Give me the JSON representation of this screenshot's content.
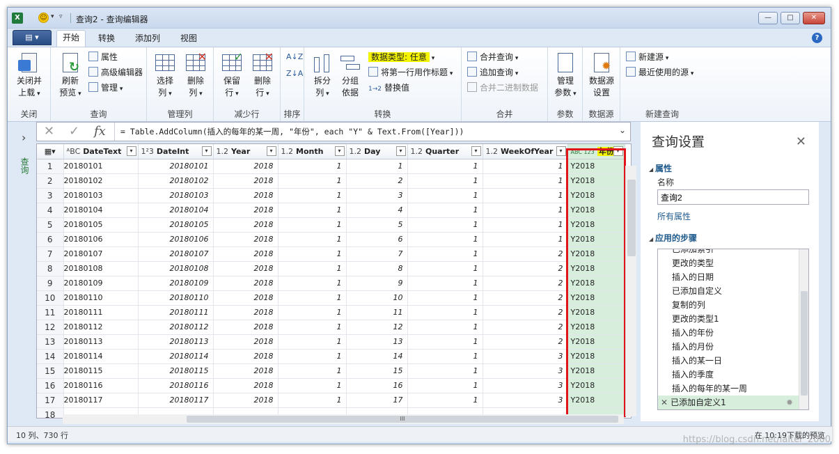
{
  "window": {
    "app_icon": "X",
    "title": "查询2 - 查询编辑器",
    "buttons": {
      "minimize": "—",
      "maximize": "□",
      "close": "✕"
    }
  },
  "ribbon_tabs": {
    "file": "▤ ▾",
    "tabs": [
      "开始",
      "转换",
      "添加列",
      "视图"
    ]
  },
  "ribbon": {
    "close": {
      "btn": "关闭并\n上载",
      "label1": "关闭并",
      "label2": "上载",
      "group": "关闭"
    },
    "query": {
      "refresh1": "刷新",
      "refresh2": "预览",
      "properties": "属性",
      "advanced_editor": "高级编辑器",
      "manage": "管理",
      "group": "查询"
    },
    "manage_cols": {
      "choose1": "选择",
      "choose2": "列",
      "remove1": "删除",
      "remove2": "列",
      "group": "管理列"
    },
    "reduce_rows": {
      "keep1": "保留",
      "keep2": "行",
      "remove1": "删除",
      "remove2": "行",
      "group": "减少行"
    },
    "sort": {
      "group": "排序"
    },
    "transform": {
      "split1": "拆分",
      "split2": "列",
      "group_by1": "分组",
      "group_by2": "依据",
      "data_type": "数据类型: 任意",
      "first_row_header": "将第一行用作标题",
      "replace_values": "替换值",
      "group": "转换"
    },
    "combine": {
      "merge": "合并查询",
      "append": "追加查询",
      "combine_binaries": "合并二进制数据",
      "group": "合并"
    },
    "params": {
      "manage1": "管理",
      "manage2": "参数",
      "group": "参数"
    },
    "datasource": {
      "settings1": "数据源",
      "settings2": "设置",
      "group": "数据源"
    },
    "new_query": {
      "new_source": "新建源",
      "recent_sources": "最近使用的源",
      "group": "新建查询"
    }
  },
  "left_nav": {
    "label": "查询",
    "arrow": "›"
  },
  "formula_bar": {
    "cancel": "✕",
    "accept": "✓",
    "fx": "fx",
    "formula": "= Table.AddColumn(插入的每年的某一周, \"年份\", each \"Y\" & Text.From([Year]))"
  },
  "grid": {
    "columns": [
      {
        "type": "ᴬBC",
        "name": "DateText"
      },
      {
        "type": "1²3",
        "name": "DateInt"
      },
      {
        "type": "1.2",
        "name": "Year"
      },
      {
        "type": "1.2",
        "name": "Month"
      },
      {
        "type": "1.2",
        "name": "Day"
      },
      {
        "type": "1.2",
        "name": "Quarter"
      },
      {
        "type": "1.2",
        "name": "WeekOfYear"
      },
      {
        "type": "ABC 123",
        "name": "年份"
      }
    ],
    "rows": [
      {
        "n": "1",
        "dt": "20180101",
        "di": "20180101",
        "y": "2018",
        "m": "1",
        "d": "1",
        "q": "1",
        "w": "1",
        "nf": "Y2018"
      },
      {
        "n": "2",
        "dt": "20180102",
        "di": "20180102",
        "y": "2018",
        "m": "1",
        "d": "2",
        "q": "1",
        "w": "1",
        "nf": "Y2018"
      },
      {
        "n": "3",
        "dt": "20180103",
        "di": "20180103",
        "y": "2018",
        "m": "1",
        "d": "3",
        "q": "1",
        "w": "1",
        "nf": "Y2018"
      },
      {
        "n": "4",
        "dt": "20180104",
        "di": "20180104",
        "y": "2018",
        "m": "1",
        "d": "4",
        "q": "1",
        "w": "1",
        "nf": "Y2018"
      },
      {
        "n": "5",
        "dt": "20180105",
        "di": "20180105",
        "y": "2018",
        "m": "1",
        "d": "5",
        "q": "1",
        "w": "1",
        "nf": "Y2018"
      },
      {
        "n": "6",
        "dt": "20180106",
        "di": "20180106",
        "y": "2018",
        "m": "1",
        "d": "6",
        "q": "1",
        "w": "1",
        "nf": "Y2018"
      },
      {
        "n": "7",
        "dt": "20180107",
        "di": "20180107",
        "y": "2018",
        "m": "1",
        "d": "7",
        "q": "1",
        "w": "2",
        "nf": "Y2018"
      },
      {
        "n": "8",
        "dt": "20180108",
        "di": "20180108",
        "y": "2018",
        "m": "1",
        "d": "8",
        "q": "1",
        "w": "2",
        "nf": "Y2018"
      },
      {
        "n": "9",
        "dt": "20180109",
        "di": "20180109",
        "y": "2018",
        "m": "1",
        "d": "9",
        "q": "1",
        "w": "2",
        "nf": "Y2018"
      },
      {
        "n": "10",
        "dt": "20180110",
        "di": "20180110",
        "y": "2018",
        "m": "1",
        "d": "10",
        "q": "1",
        "w": "2",
        "nf": "Y2018"
      },
      {
        "n": "11",
        "dt": "20180111",
        "di": "20180111",
        "y": "2018",
        "m": "1",
        "d": "11",
        "q": "1",
        "w": "2",
        "nf": "Y2018"
      },
      {
        "n": "12",
        "dt": "20180112",
        "di": "20180112",
        "y": "2018",
        "m": "1",
        "d": "12",
        "q": "1",
        "w": "2",
        "nf": "Y2018"
      },
      {
        "n": "13",
        "dt": "20180113",
        "di": "20180113",
        "y": "2018",
        "m": "1",
        "d": "13",
        "q": "1",
        "w": "2",
        "nf": "Y2018"
      },
      {
        "n": "14",
        "dt": "20180114",
        "di": "20180114",
        "y": "2018",
        "m": "1",
        "d": "14",
        "q": "1",
        "w": "3",
        "nf": "Y2018"
      },
      {
        "n": "15",
        "dt": "20180115",
        "di": "20180115",
        "y": "2018",
        "m": "1",
        "d": "15",
        "q": "1",
        "w": "3",
        "nf": "Y2018"
      },
      {
        "n": "16",
        "dt": "20180116",
        "di": "20180116",
        "y": "2018",
        "m": "1",
        "d": "16",
        "q": "1",
        "w": "3",
        "nf": "Y2018"
      },
      {
        "n": "17",
        "dt": "20180117",
        "di": "20180117",
        "y": "2018",
        "m": "1",
        "d": "17",
        "q": "1",
        "w": "3",
        "nf": "Y2018"
      },
      {
        "n": "18",
        "dt": "",
        "di": "",
        "y": "",
        "m": "",
        "d": "",
        "q": "",
        "w": "",
        "nf": ""
      }
    ],
    "scroll_glyph": "III"
  },
  "settings_pane": {
    "title": "查询设置",
    "close": "✕",
    "properties_heading": "属性",
    "name_label": "名称",
    "name_value": "查询2",
    "all_properties": "所有属性",
    "steps_heading": "应用的步骤",
    "steps": [
      "已添加索引",
      "更改的类型",
      "插入的日期",
      "已添加自定义",
      "复制的列",
      "更改的类型1",
      "插入的年份",
      "插入的月份",
      "插入的某一日",
      "插入的季度",
      "插入的每年的某一周"
    ],
    "active_step": "已添加自定义1"
  },
  "status": {
    "left": "10 列、730 行",
    "right": "在 10:19下载的预览"
  },
  "watermark": "https://blog.csdn.net/lalter_2000",
  "colors": {
    "accent_yellow": "#f5f500",
    "highlight_red": "#e0141a",
    "new_col_green": "#d8eedd"
  }
}
